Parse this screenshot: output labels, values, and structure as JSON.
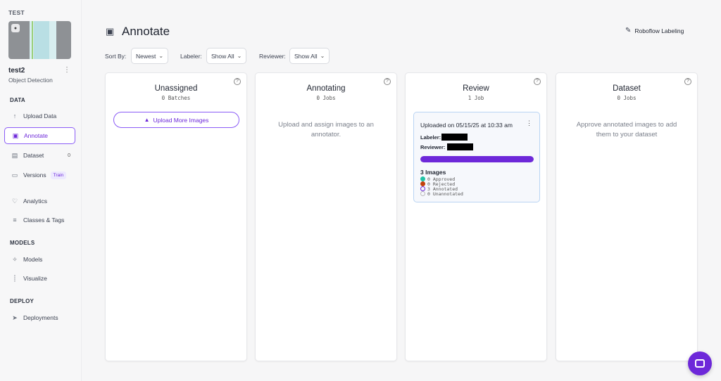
{
  "sidebar": {
    "workspace": "TEST",
    "project_name": "test2",
    "project_type": "Object Detection",
    "sections": {
      "data": "DATA",
      "models": "MODELS",
      "deploy": "DEPLOY"
    },
    "items": {
      "upload": {
        "label": "Upload Data",
        "icon": "arrow-up-icon"
      },
      "annotate": {
        "label": "Annotate",
        "icon": "annotate-icon"
      },
      "dataset": {
        "label": "Dataset",
        "icon": "images-icon",
        "badge": "0"
      },
      "versions": {
        "label": "Versions",
        "icon": "versions-icon",
        "tag": "Train"
      },
      "analytics": {
        "label": "Analytics",
        "icon": "heart-pulse-icon"
      },
      "classes": {
        "label": "Classes & Tags",
        "icon": "list-icon"
      },
      "models": {
        "label": "Models",
        "icon": "models-icon"
      },
      "visualize": {
        "label": "Visualize",
        "icon": "chart-icon"
      },
      "deployments": {
        "label": "Deployments",
        "icon": "rocket-icon"
      }
    }
  },
  "header": {
    "title": "Annotate",
    "roboflow_labeling": "Roboflow Labeling"
  },
  "filters": {
    "sort_label": "Sort By:",
    "sort_value": "Newest",
    "labeler_label": "Labeler:",
    "labeler_value": "Show All",
    "reviewer_label": "Reviewer:",
    "reviewer_value": "Show All"
  },
  "columns": {
    "unassigned": {
      "title": "Unassigned",
      "sub": "0 Batches",
      "button": "Upload More Images"
    },
    "annotating": {
      "title": "Annotating",
      "sub": "0 Jobs",
      "empty": "Upload and assign images to an annotator."
    },
    "review": {
      "title": "Review",
      "sub": "1 Job",
      "job": {
        "uploaded": "Uploaded on 05/15/25 at 10:33 am",
        "labeler_label": "Labeler:",
        "reviewer_label": "Reviewer:",
        "progress": 1.0,
        "count": "3 Images",
        "approved": "0 Approved",
        "rejected": "0 Rejected",
        "annotated": "3 Annotated",
        "unannotated": "0 Unannotated"
      }
    },
    "dataset": {
      "title": "Dataset",
      "sub": "0 Jobs",
      "empty": "Approve annotated images to add them to your dataset"
    }
  },
  "colors": {
    "accent": "#6d28d9",
    "approved": "#22c3a6",
    "rejected": "#c2410c"
  }
}
